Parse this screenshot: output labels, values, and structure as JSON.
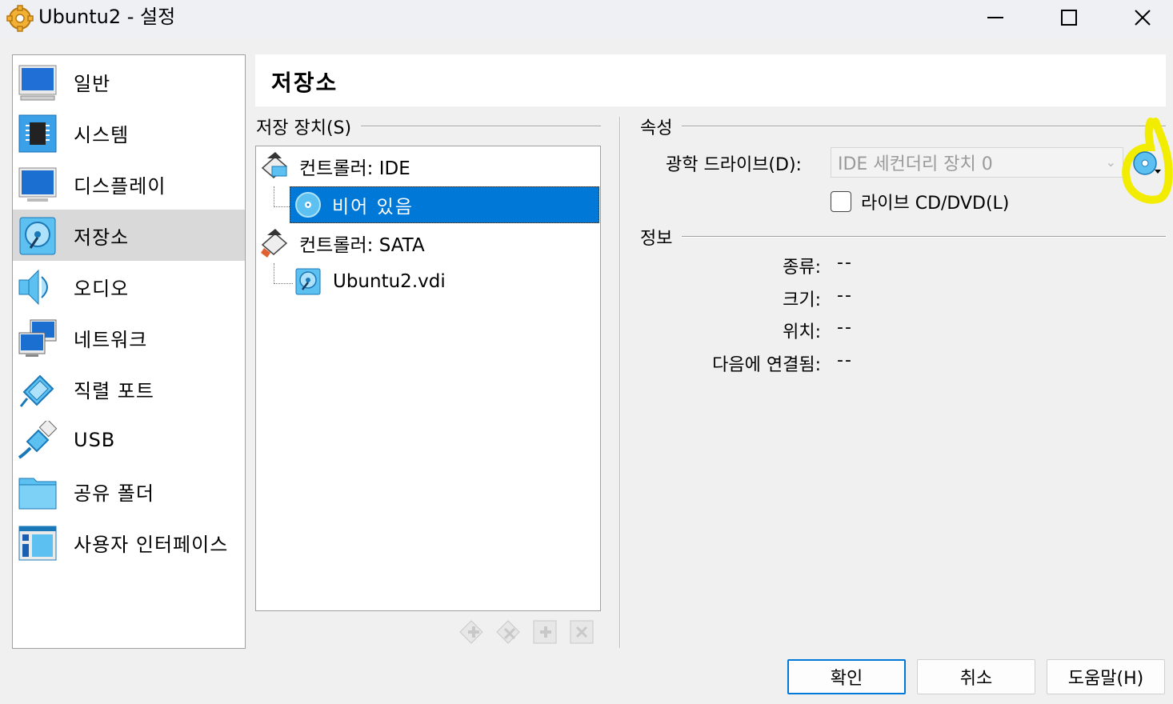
{
  "window": {
    "title": "Ubuntu2 - 설정"
  },
  "sidebar": {
    "items": [
      {
        "label": "일반",
        "icon": "monitor-icon"
      },
      {
        "label": "시스템",
        "icon": "chip-icon"
      },
      {
        "label": "디스플레이",
        "icon": "display-icon"
      },
      {
        "label": "저장소",
        "icon": "storage-icon",
        "selected": true
      },
      {
        "label": "오디오",
        "icon": "speaker-icon"
      },
      {
        "label": "네트워크",
        "icon": "network-icon"
      },
      {
        "label": "직렬 포트",
        "icon": "serial-port-icon"
      },
      {
        "label": "USB",
        "icon": "usb-icon"
      },
      {
        "label": "공유 폴더",
        "icon": "folder-icon"
      },
      {
        "label": "사용자 인터페이스",
        "icon": "ui-icon"
      }
    ]
  },
  "header": {
    "title": "저장소"
  },
  "storage_devices": {
    "heading": "저장 장치(S)",
    "tree": [
      {
        "label": "컨트롤러: IDE",
        "type": "controller"
      },
      {
        "label": "비어 있음",
        "type": "optical",
        "selected": true
      },
      {
        "label": "컨트롤러: SATA",
        "type": "controller"
      },
      {
        "label": "Ubuntu2.vdi",
        "type": "disk"
      }
    ]
  },
  "attributes": {
    "heading": "속성",
    "optical_drive_label": "광학 드라이브(D):",
    "optical_drive_value": "IDE 세컨더리 장치 0",
    "live_cd_label": "라이브 CD/DVD(L)",
    "live_cd_checked": false
  },
  "info": {
    "heading": "정보",
    "rows": [
      {
        "label": "종류:",
        "value": "--"
      },
      {
        "label": "크기:",
        "value": "--"
      },
      {
        "label": "위치:",
        "value": "--"
      },
      {
        "label": "다음에 연결됨:",
        "value": "--"
      }
    ]
  },
  "buttons": {
    "ok": "확인",
    "cancel": "취소",
    "help": "도움말(H)"
  },
  "colors": {
    "accent": "#0078d7",
    "highlight": "#f2ec00"
  }
}
